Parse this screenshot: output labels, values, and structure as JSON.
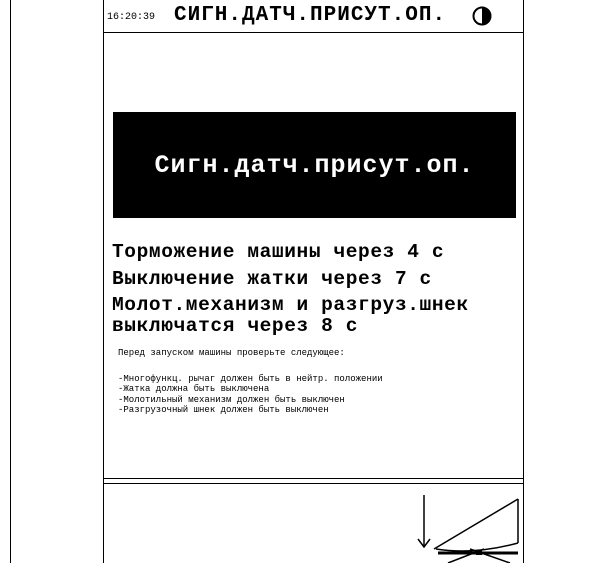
{
  "header": {
    "clock": "16:20:39",
    "title": "СИГН.ДАТЧ.ПРИСУТ.ОП.",
    "daynight_icon": "day-night-mode-icon"
  },
  "banner": {
    "text": "Сигн.датч.присут.оп."
  },
  "messages": {
    "braking": "Торможение машины через 4 с",
    "header_off": "Выключение жатки через 7 с",
    "threshing_line1": "Молот.механизм и разгруз.шнек",
    "threshing_line2": "выключатся через 8 с"
  },
  "checklist": {
    "intro": "Перед запуском машины проверьте следующее:",
    "items": [
      "-Многофункц. рычаг должен быть в нейтр. положении",
      "-Жатка должна быть выключена",
      "-Молотильный механизм должен быть выключен",
      "-Разгрузочный шнек должен быть выключен"
    ]
  },
  "footer": {
    "icon": "header-lowering-arrow-icon"
  }
}
